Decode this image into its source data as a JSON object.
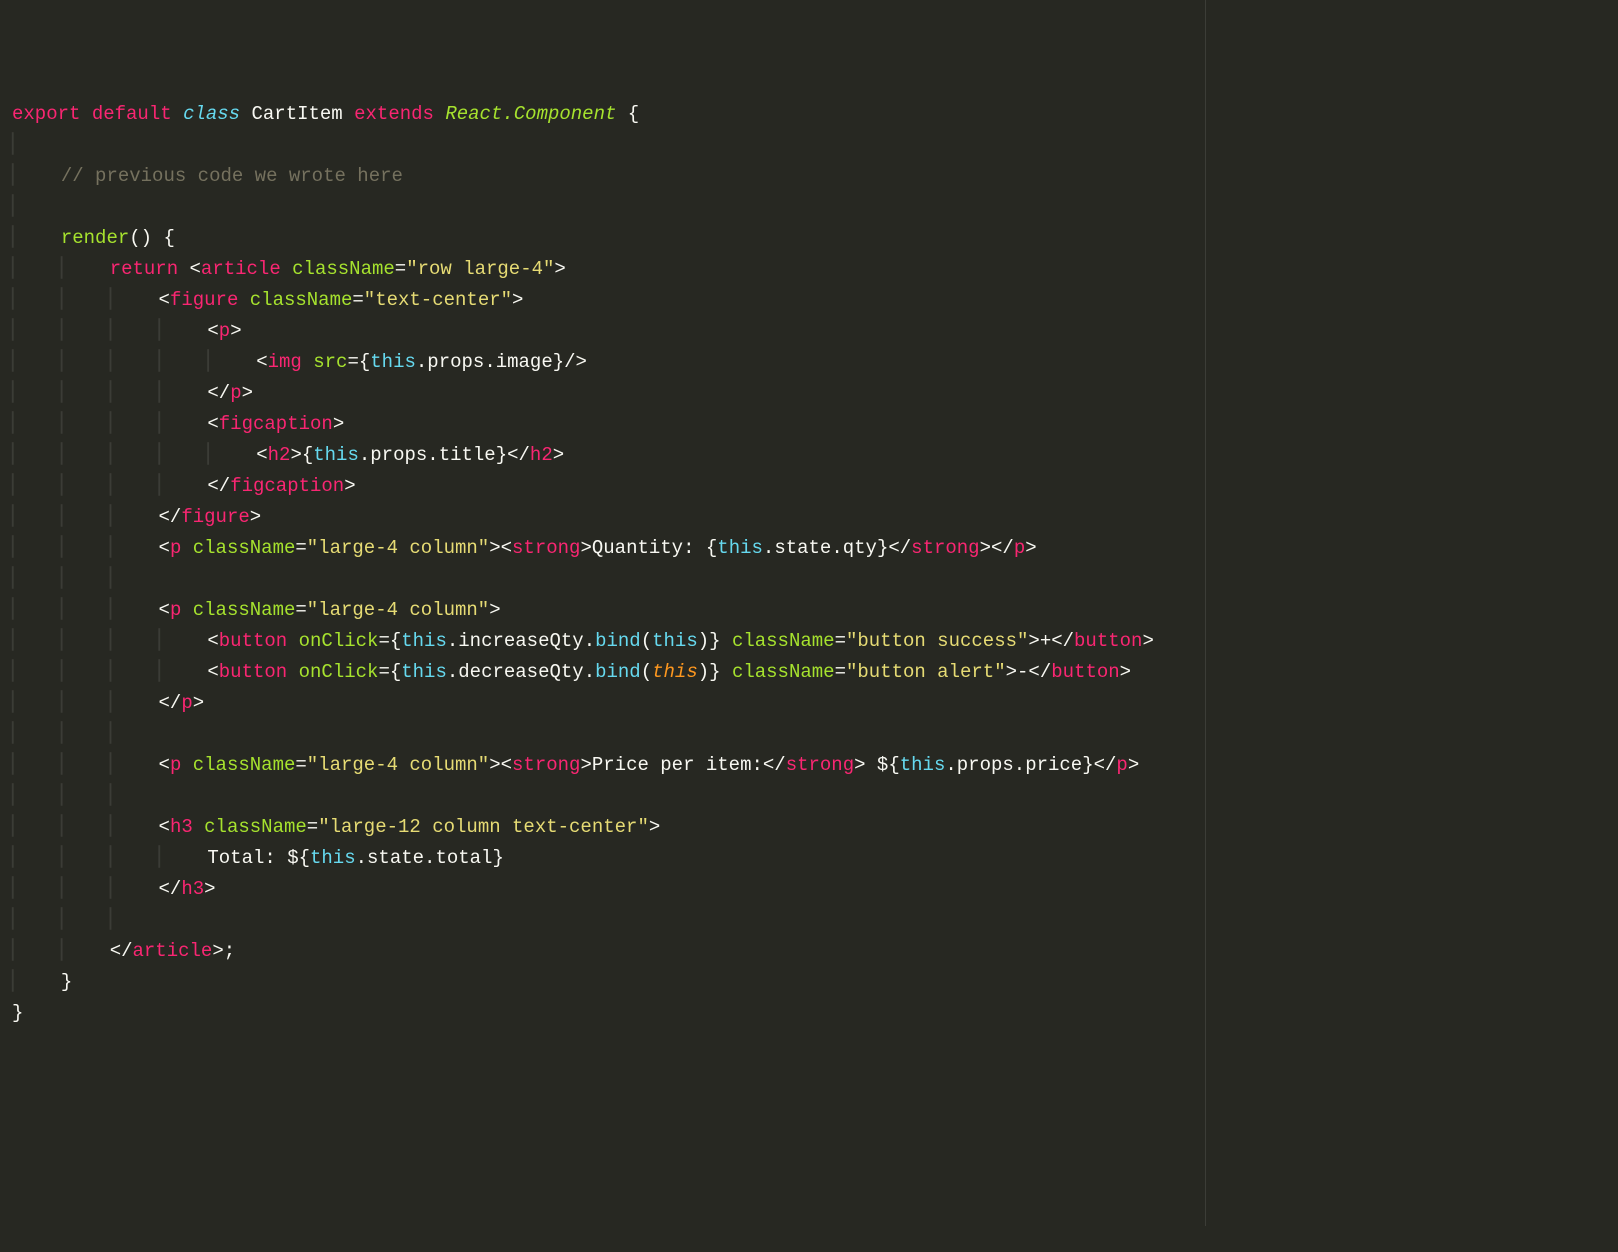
{
  "l1": {
    "export": "export",
    "default": "default",
    "class": "class",
    "name": "CartItem",
    "extends": "extends",
    "react": "React",
    "dot": ".",
    "component": "Component",
    "brace": "{"
  },
  "l2": "",
  "l3": "// previous code we wrote here",
  "l4": "",
  "l5": {
    "render": "render",
    "parens": "()",
    "brace": "{"
  },
  "l6": {
    "return": "return",
    "lt": "<",
    "tag": "article",
    "sp": " ",
    "attr": "className",
    "eq": "=",
    "str": "\"row large-4\"",
    "gt": ">"
  },
  "l7": {
    "lt": "<",
    "tag": "figure",
    "attr": "className",
    "eq": "=",
    "str": "\"text-center\"",
    "gt": ">"
  },
  "l8": {
    "lt": "<",
    "tag": "p",
    "gt": ">"
  },
  "l9": {
    "lt": "<",
    "tag": "img",
    "attr": "src",
    "eq": "=",
    "ob": "{",
    "this": "this",
    "d1": ".",
    "p": "props",
    "d2": ".",
    "f": "image",
    "cb": "}",
    "slash": "/",
    "gt": ">"
  },
  "l10": {
    "lt": "</",
    "tag": "p",
    "gt": ">"
  },
  "l11": {
    "lt": "<",
    "tag": "figcaption",
    "gt": ">"
  },
  "l12": {
    "lt1": "<",
    "tag1": "h2",
    "gt1": ">",
    "ob": "{",
    "this": "this",
    "d1": ".",
    "p": "props",
    "d2": ".",
    "f": "title",
    "cb": "}",
    "lt2": "</",
    "tag2": "h2",
    "gt2": ">"
  },
  "l13": {
    "lt": "</",
    "tag": "figcaption",
    "gt": ">"
  },
  "l14": {
    "lt": "</",
    "tag": "figure",
    "gt": ">"
  },
  "l15": {
    "lt1": "<",
    "tag1": "p",
    "attr": "className",
    "eq": "=",
    "str": "\"large-4 column\"",
    "gt1": ">",
    "lt2": "<",
    "tag2": "strong",
    "gt2": ">",
    "txt": "Quantity: ",
    "ob": "{",
    "this": "this",
    "d1": ".",
    "p": "state",
    "d2": ".",
    "f": "qty",
    "cb": "}",
    "lt3": "</",
    "tag3": "strong",
    "gt3": ">",
    "lt4": "</",
    "tag4": "p",
    "gt4": ">"
  },
  "l16": "",
  "l17": {
    "lt": "<",
    "tag": "p",
    "attr": "className",
    "eq": "=",
    "str": "\"large-4 column\"",
    "gt": ">"
  },
  "l18": {
    "lt1": "<",
    "tag1": "button",
    "a1": "onClick",
    "eq1": "=",
    "ob": "{",
    "this1": "this",
    "d1": ".",
    "fn": "increaseQty",
    "d2": ".",
    "bind": "bind",
    "op": "(",
    "this2": "this",
    "cp": ")",
    "cb": "}",
    "a2": "className",
    "eq2": "=",
    "str": "\"button success\"",
    "gt1": ">",
    "txt": "+",
    "lt2": "</",
    "tag2": "button",
    "gt2": ">"
  },
  "l19": {
    "lt1": "<",
    "tag1": "button",
    "a1": "onClick",
    "eq1": "=",
    "ob": "{",
    "this1": "this",
    "d1": ".",
    "fn": "decreaseQty",
    "d2": ".",
    "bind": "bind",
    "op": "(",
    "this2": "this",
    "cp": ")",
    "cb": "}",
    "a2": "className",
    "eq2": "=",
    "str": "\"button alert\"",
    "gt1": ">",
    "txt": "-",
    "lt2": "</",
    "tag2": "button",
    "gt2": ">"
  },
  "l20": {
    "lt": "</",
    "tag": "p",
    "gt": ">"
  },
  "l21": "",
  "l22": {
    "lt1": "<",
    "tag1": "p",
    "attr": "className",
    "eq": "=",
    "str": "\"large-4 column\"",
    "gt1": ">",
    "lt2": "<",
    "tag2": "strong",
    "gt2": ">",
    "txt": "Price per item:",
    "lt3": "</",
    "tag3": "strong",
    "gt3": ">",
    "sp": " $",
    "ob": "{",
    "this": "this",
    "d1": ".",
    "p": "props",
    "d2": ".",
    "f": "price",
    "cb": "}",
    "lt4": "</",
    "tag4": "p",
    "gt4": ">"
  },
  "l23": "",
  "l24": {
    "lt": "<",
    "tag": "h3",
    "attr": "className",
    "eq": "=",
    "str": "\"large-12 column text-center\"",
    "gt": ">"
  },
  "l25": {
    "txt": "Total: $",
    "ob": "{",
    "this": "this",
    "d1": ".",
    "p": "state",
    "d2": ".",
    "f": "total",
    "cb": "}"
  },
  "l26": {
    "lt": "</",
    "tag": "h3",
    "gt": ">"
  },
  "l27": "",
  "l28": {
    "lt": "</",
    "tag": "article",
    "gt": ">",
    "semi": ";"
  },
  "l29": "}",
  "l30": "}"
}
